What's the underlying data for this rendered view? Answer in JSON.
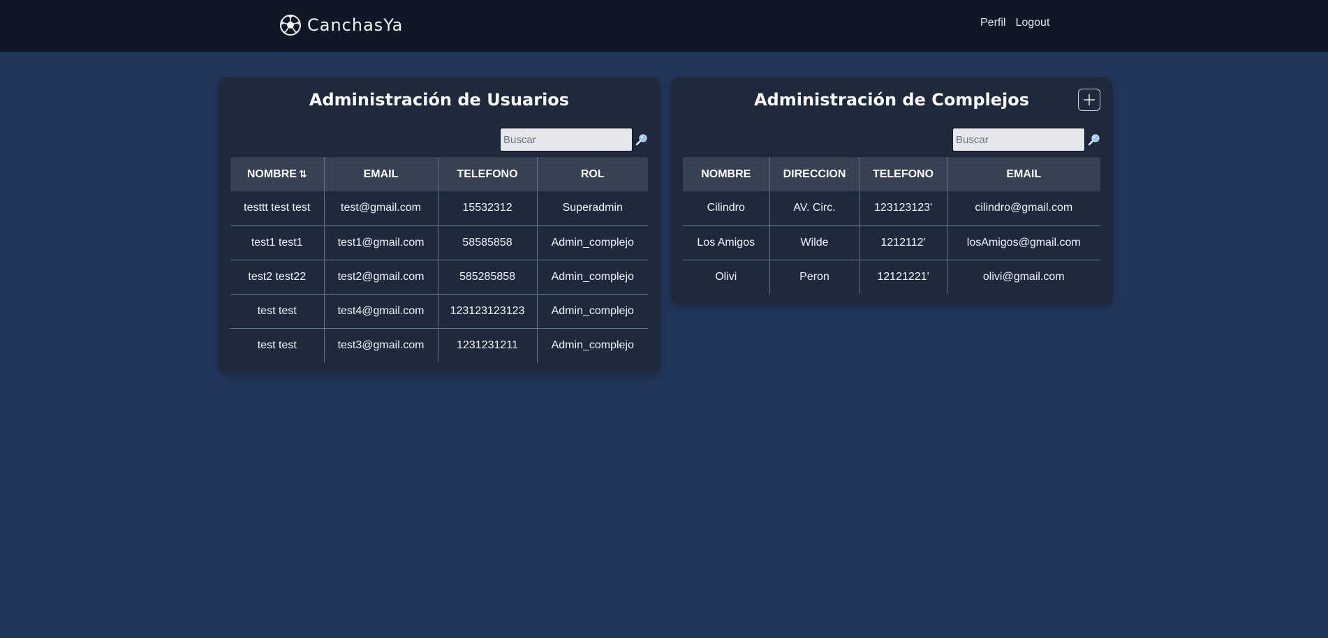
{
  "brand": {
    "name": "CanchasYa",
    "icon": "soccer-ball-icon"
  },
  "nav": {
    "links": [
      "Perfil",
      "Logout"
    ]
  },
  "users": {
    "title": "Administración de Usuarios",
    "search_placeholder": "Buscar",
    "columns": [
      "NOMBRE",
      "EMAIL",
      "TELEFONO",
      "ROL"
    ],
    "sort_icon": "sort-icon",
    "rows": [
      [
        "testtt test test",
        "test@gmail.com",
        "15532312",
        "Superadmin"
      ],
      [
        "test1 test1",
        "test1@gmail.com",
        "58585858",
        "Admin_complejo"
      ],
      [
        "test2 test22",
        "test2@gmail.com",
        "585285858",
        "Admin_complejo"
      ],
      [
        "test test",
        "test4@gmail.com",
        "123123123123",
        "Admin_complejo"
      ],
      [
        "test test",
        "test3@gmail.com",
        "1231231211",
        "Admin_complejo"
      ]
    ]
  },
  "complejos": {
    "title": "Administración de Complejos",
    "search_placeholder": "Buscar",
    "columns": [
      "NOMBRE",
      "DIRECCION",
      "TELEFONO",
      "EMAIL"
    ],
    "rows": [
      [
        "Cilindro",
        "AV. Circ.",
        "123123123'",
        "cilindro@gmail.com"
      ],
      [
        "Los Amigos",
        "Wilde",
        "1212112'",
        "losAmigos@gmail.com"
      ],
      [
        "Olivi",
        "Peron",
        "12121221'",
        "olivi@gmail.com"
      ]
    ]
  },
  "colors": {
    "background": "#22355a",
    "navbar": "#101828",
    "card": "#1e293b",
    "table_header": "#374151"
  }
}
